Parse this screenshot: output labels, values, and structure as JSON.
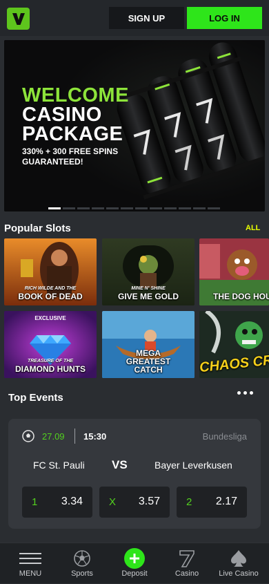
{
  "header": {
    "logo_letter": "V",
    "signup_label": "SIGN UP",
    "login_label": "LOG IN",
    "brand_color": "#5ec51d",
    "login_color": "#2ee51a"
  },
  "banner": {
    "line1": "WELCOME",
    "line2": "CASINO",
    "line3": "PACKAGE",
    "sub1": "330% + 300 FREE SPINS",
    "sub2": "GUARANTEED!",
    "slide_count": 12,
    "active_slide": 1
  },
  "popular_slots": {
    "title": "Popular Slots",
    "all_label": "ALL",
    "tiles": [
      {
        "label": "BOOK OF DEAD",
        "subtitle": "RICH WILDE AND THE",
        "tag": ""
      },
      {
        "label": "GIVE ME GOLD",
        "subtitle": "MINE N' SHINE",
        "tag": ""
      },
      {
        "label": "THE DOG HOU",
        "subtitle": "",
        "tag": ""
      },
      {
        "label": "DIAMOND HUNTS",
        "subtitle": "TREASURE OF THE",
        "tag": "EXCLUSIVE"
      },
      {
        "label": "MEGA GREATEST CATCH",
        "subtitle": "",
        "tag": ""
      },
      {
        "label": "CHAOS CREW",
        "subtitle": "",
        "tag": ""
      }
    ]
  },
  "top_events": {
    "title": "Top Events",
    "event": {
      "date": "27.09",
      "time": "15:30",
      "league": "Bundesliga",
      "home": "FC St. Pauli",
      "vs": "VS",
      "away": "Bayer Leverkusen",
      "odds": [
        {
          "key": "1",
          "value": "3.34"
        },
        {
          "key": "X",
          "value": "3.57"
        },
        {
          "key": "2",
          "value": "2.17"
        }
      ]
    }
  },
  "bottom_nav": {
    "items": [
      {
        "label": "MENU",
        "icon": "hamburger-icon"
      },
      {
        "label": "Sports",
        "icon": "soccer-ball-icon"
      },
      {
        "label": "Deposit",
        "icon": "plus-circle-icon"
      },
      {
        "label": "Casino",
        "icon": "seven-icon"
      },
      {
        "label": "Live Casino",
        "icon": "spade-icon"
      }
    ]
  }
}
